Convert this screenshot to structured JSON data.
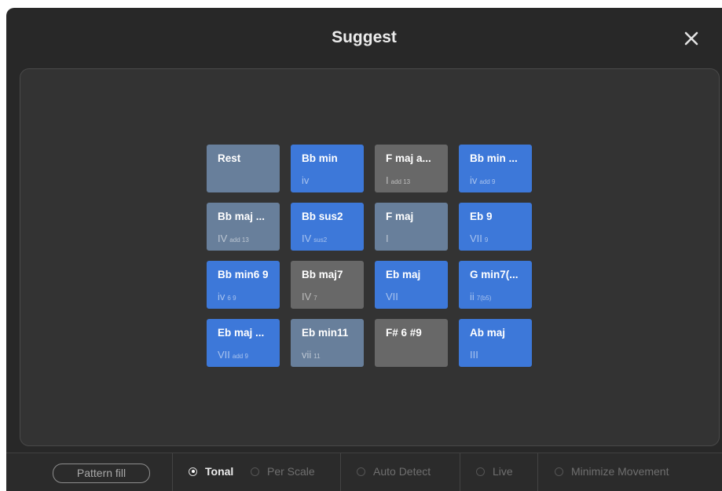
{
  "dialog": {
    "title": "Suggest"
  },
  "pads": [
    {
      "name": "Rest",
      "degree": "",
      "ext": "",
      "color": "slate"
    },
    {
      "name": "Bb min",
      "degree": "iv",
      "ext": "",
      "color": "blue"
    },
    {
      "name": "F maj a...",
      "degree": "I",
      "ext": "add 13",
      "color": "gray"
    },
    {
      "name": "Bb min ...",
      "degree": "iv",
      "ext": "add 9",
      "color": "blue"
    },
    {
      "name": "Bb maj ...",
      "degree": "IV",
      "ext": "add 13",
      "color": "slate"
    },
    {
      "name": "Bb sus2",
      "degree": "IV",
      "ext": "sus2",
      "color": "blue"
    },
    {
      "name": "F maj",
      "degree": "I",
      "ext": "",
      "color": "slate"
    },
    {
      "name": "Eb 9",
      "degree": "VII",
      "ext": "9",
      "color": "blue"
    },
    {
      "name": "Bb min6 9",
      "degree": "iv",
      "ext": "6 9",
      "color": "blue"
    },
    {
      "name": "Bb maj7",
      "degree": "IV",
      "ext": "7",
      "color": "gray"
    },
    {
      "name": "Eb maj",
      "degree": "VII",
      "ext": "",
      "color": "blue"
    },
    {
      "name": "G min7(...",
      "degree": "ii",
      "ext": "7(b5)",
      "color": "blue"
    },
    {
      "name": "Eb maj ...",
      "degree": "VII",
      "ext": "add 9",
      "color": "blue"
    },
    {
      "name": "Eb min11",
      "degree": "vii",
      "ext": "11",
      "color": "slate"
    },
    {
      "name": "F# 6 #9",
      "degree": "",
      "ext": "",
      "color": "gray"
    },
    {
      "name": "Ab maj",
      "degree": "III",
      "ext": "",
      "color": "blue"
    }
  ],
  "bottom_bar": {
    "pattern_fill": "Pattern fill",
    "tonal": "Tonal",
    "per_scale": "Per Scale",
    "auto_detect": "Auto Detect",
    "live": "Live",
    "minimize_movement": "Minimize Movement"
  },
  "colors": {
    "blue": "#3d78d9",
    "slate": "#687f9b",
    "gray": "#686868"
  }
}
